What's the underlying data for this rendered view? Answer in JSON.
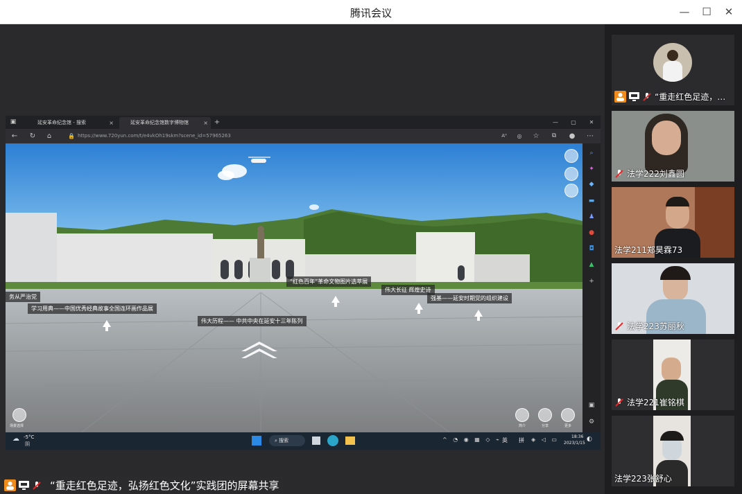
{
  "window": {
    "title": "腾讯会议",
    "minimize": "—",
    "maximize": "☐",
    "close": "✕"
  },
  "browser": {
    "tabs": [
      {
        "label": "延安革命纪念馆 - 搜索",
        "close": "×"
      },
      {
        "label": "延安革命纪念馆数字博物馆",
        "close": "×"
      }
    ],
    "new_tab": "+",
    "url_host": "https://www.720yun.com",
    "url_path": "/t/e4vkOh19skm?scene_id=57965263",
    "window_controls": [
      "—",
      "▢",
      "✕"
    ]
  },
  "pano": {
    "hotspots": [
      {
        "label": "“红色百年”革命文物图片选萃展"
      },
      {
        "label": "伟大长征 辉煌史诗"
      },
      {
        "label": "强基——延安时期党的组织建设"
      },
      {
        "label": "务从严治党"
      },
      {
        "label": "学习用典——中国优秀经典故事全国连环画作品展"
      },
      {
        "label": "伟大历程—— 中共中央在延安十三年陈列"
      }
    ],
    "bottom_left_label": "场景选择",
    "bottom_right_labels": [
      "简介",
      "分享",
      "更多"
    ]
  },
  "taskbar": {
    "weather_temp": "-5°C",
    "weather_desc": "阴",
    "search_label": "搜索",
    "ime_1": "英",
    "ime_2": "拼",
    "time": "18:36",
    "date": "2023/1/15"
  },
  "share_status": {
    "text": "“重走红色足迹，弘扬红色文化”实践团的屏幕共享"
  },
  "participants": [
    {
      "name": "“重走红色足迹，…",
      "host": true
    },
    {
      "name": "法学222刘鑫圆"
    },
    {
      "name": "法学211郑昊霖73"
    },
    {
      "name": "法学223苏丽秋"
    },
    {
      "name": "法学221崔铭棋"
    },
    {
      "name": "法学223张舒心"
    }
  ],
  "colors": {
    "accent_orange": "#f08c1e",
    "mic_muted_red": "#e02b2b",
    "titlebar_bg": "#ffffff",
    "panel_bg": "#1e1e20"
  }
}
